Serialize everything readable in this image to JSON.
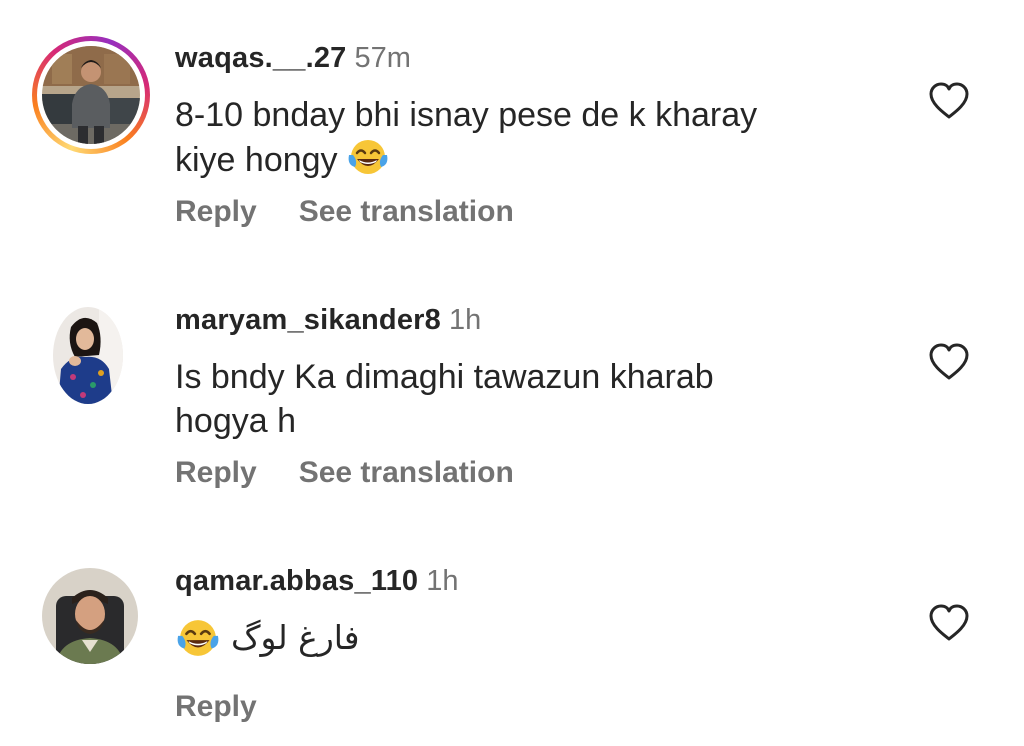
{
  "comments": [
    {
      "username": "waqas.__.27",
      "time": "57m",
      "text_line1": "8-10 bnday bhi isnay pese de k kharay",
      "text_line2": "kiye hongy",
      "emoji": "face-with-tears-of-joy",
      "reply_label": "Reply",
      "translate_label": "See translation",
      "has_story_ring": true
    },
    {
      "username": "maryam_sikander8",
      "time": "1h",
      "text_line1": "Is bndy Ka dimaghi tawazun kharab",
      "text_line2": "hogya h",
      "reply_label": "Reply",
      "translate_label": "See translation",
      "has_story_ring": false
    },
    {
      "username": "qamar.abbas_110",
      "time": "1h",
      "text_urdu": "فارغ لوگ",
      "emoji": "face-with-tears-of-joy",
      "reply_label": "Reply",
      "has_story_ring": false
    }
  ],
  "colors": {
    "text": "#262626",
    "secondary": "#737373",
    "emoji_face": "#f7c637"
  },
  "icons": {
    "like": "heart-outline-icon"
  }
}
